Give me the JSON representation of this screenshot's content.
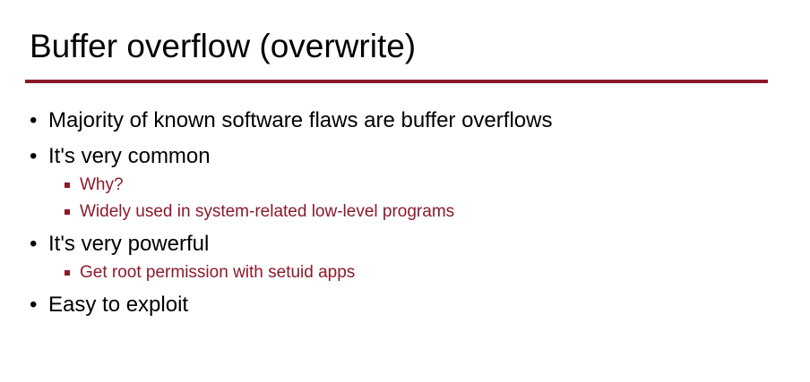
{
  "slide": {
    "title": "Buffer overflow (overwrite)",
    "accent_color": "#8b1a2b",
    "bullets": [
      {
        "text": "Majority of known software flaws are buffer overflows",
        "subs": []
      },
      {
        "text": "It's very common",
        "subs": [
          "Why?",
          "Widely used in system-related low-level programs"
        ]
      },
      {
        "text": "It's very powerful",
        "subs": [
          "Get root permission with setuid apps"
        ]
      },
      {
        "text": "Easy to exploit",
        "subs": []
      }
    ]
  }
}
